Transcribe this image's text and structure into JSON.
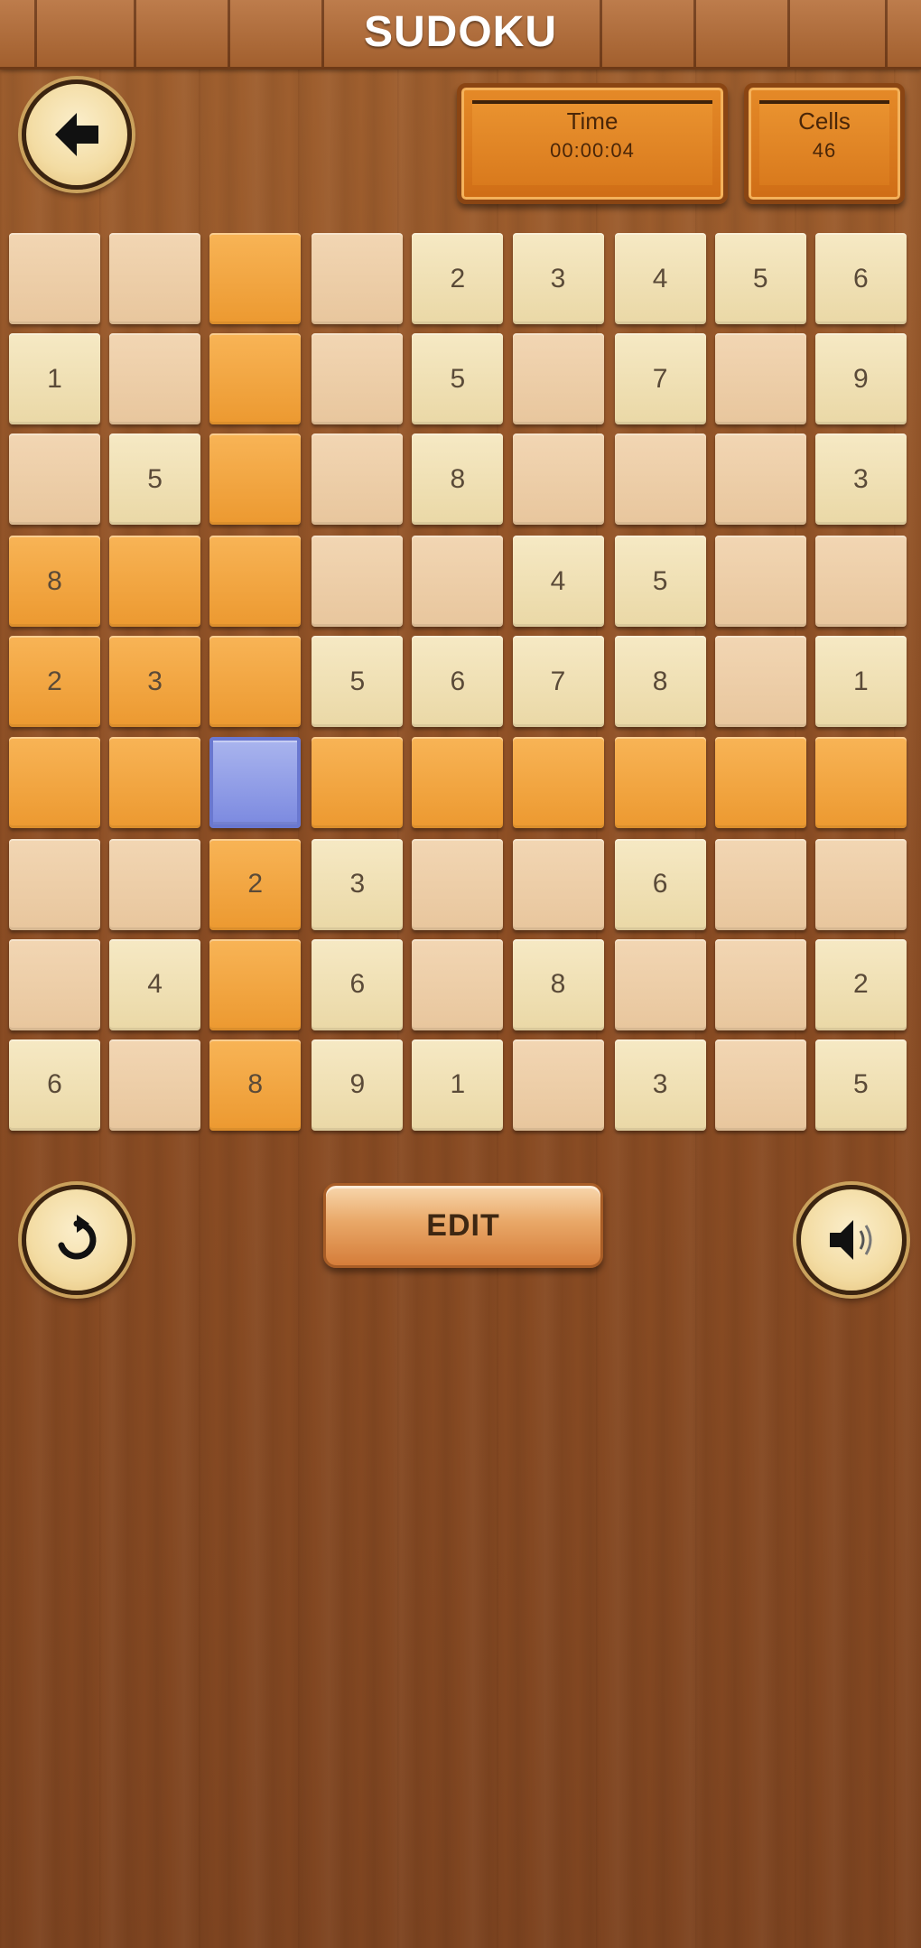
{
  "header": {
    "title": "SUDOKU"
  },
  "stats": {
    "time_label": "Time",
    "time_value": "00:00:04",
    "cells_label": "Cells",
    "cells_value": "46"
  },
  "buttons": {
    "back_icon": "arrow-left-icon",
    "restart_icon": "restart-icon",
    "sound_icon": "speaker-icon",
    "edit_label": "EDIT"
  },
  "board": {
    "selected": [
      5,
      2
    ],
    "rows": [
      [
        "",
        "",
        "",
        "",
        "2",
        "3",
        "4",
        "5",
        "6"
      ],
      [
        "1",
        "",
        "",
        "",
        "5",
        "",
        "7",
        "",
        "9"
      ],
      [
        "",
        "5",
        "",
        "",
        "8",
        "",
        "",
        "",
        "3"
      ],
      [
        "8",
        "",
        "",
        "",
        "",
        "4",
        "5",
        "",
        ""
      ],
      [
        "2",
        "3",
        "",
        "5",
        "6",
        "7",
        "8",
        "",
        "1"
      ],
      [
        "",
        "",
        "",
        "",
        "",
        "",
        "",
        "",
        ""
      ],
      [
        "",
        "",
        "2",
        "3",
        "",
        "",
        "6",
        "",
        ""
      ],
      [
        "",
        "4",
        "",
        "6",
        "",
        "8",
        "",
        "",
        "2"
      ],
      [
        "6",
        "",
        "8",
        "9",
        "1",
        "",
        "3",
        "",
        "5"
      ]
    ]
  },
  "colors": {
    "highlight": "#f0a040",
    "selected": "#8794e6",
    "given": "#f3e3b6",
    "empty": "#efd1ab"
  }
}
